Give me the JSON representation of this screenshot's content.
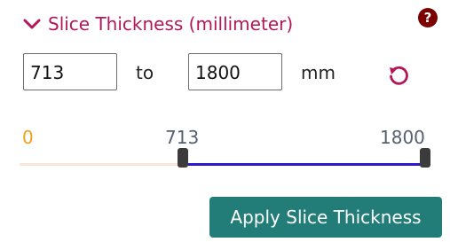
{
  "filter": {
    "title": "Slice Thickness (millimeter)",
    "expand_icon": "chevron-down-icon",
    "help_icon": "help-icon",
    "help_glyph": "?",
    "min_value": "713",
    "max_value": "1800",
    "separator_label": "to",
    "unit_label": "mm",
    "reset_icon": "reset-icon",
    "accent_color": "#b3175a",
    "slider": {
      "range_min": "0",
      "low_value": "713",
      "high_value": "1800",
      "fill_color": "#2d18cc"
    },
    "apply_label": "Apply Slice Thickness",
    "apply_color": "#227d79"
  }
}
